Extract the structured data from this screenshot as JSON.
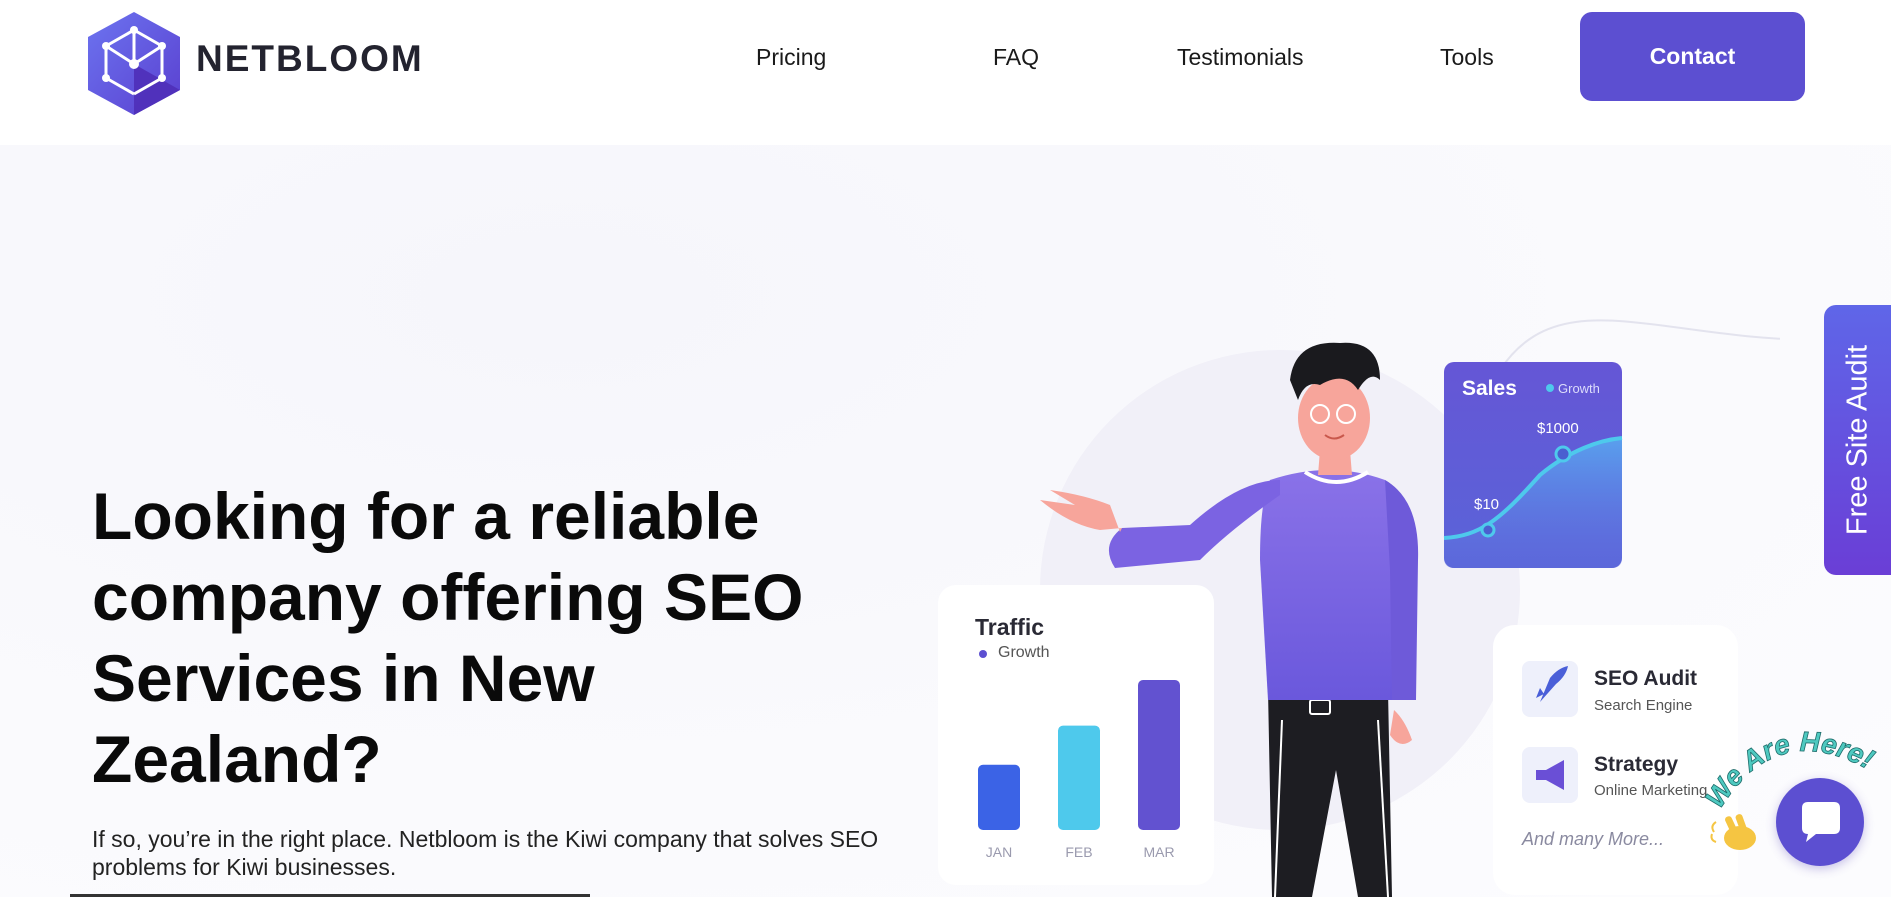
{
  "brand": {
    "name": "NETBLOOM",
    "logo_icon": "network-cube-icon",
    "color": "#5c4fd1"
  },
  "nav": {
    "items": [
      {
        "label": "Pricing"
      },
      {
        "label": "FAQ"
      },
      {
        "label": "Testimonials"
      },
      {
        "label": "Tools"
      }
    ],
    "contact_label": "Contact"
  },
  "hero": {
    "title": "Looking for a reliable company offering SEO Services in New Zealand?",
    "subtitle": "If so, you’re in the right place. Netbloom is the Kiwi company that solves SEO problems for Kiwi businesses."
  },
  "illustration": {
    "sales_card": {
      "title": "Sales",
      "legend": "Growth",
      "label_high": "$1000",
      "label_low": "$10"
    },
    "traffic_card": {
      "title": "Traffic",
      "legend": "Growth",
      "chart_data": {
        "type": "bar",
        "categories": [
          "JAN",
          "FEB",
          "MAR"
        ],
        "values": [
          50,
          80,
          115
        ],
        "colors": [
          "#3b63e6",
          "#4ec9ec",
          "#6252d0"
        ]
      }
    },
    "services_card": {
      "items": [
        {
          "title": "SEO Audit",
          "subtitle": "Search Engine",
          "icon": "rocket-icon"
        },
        {
          "title": "Strategy",
          "subtitle": "Online Marketing",
          "icon": "megaphone-icon"
        }
      ],
      "more": "And many More..."
    }
  },
  "side_tab": {
    "label": "Free Site Audit"
  },
  "chat": {
    "badge": "We Are Here!",
    "icon": "chat-bubble-icon",
    "wave_icon": "waving-hand-icon"
  },
  "colors": {
    "accent": "#5c4fd1",
    "text": "#0a0a0a",
    "background": "#fbfbfe"
  }
}
